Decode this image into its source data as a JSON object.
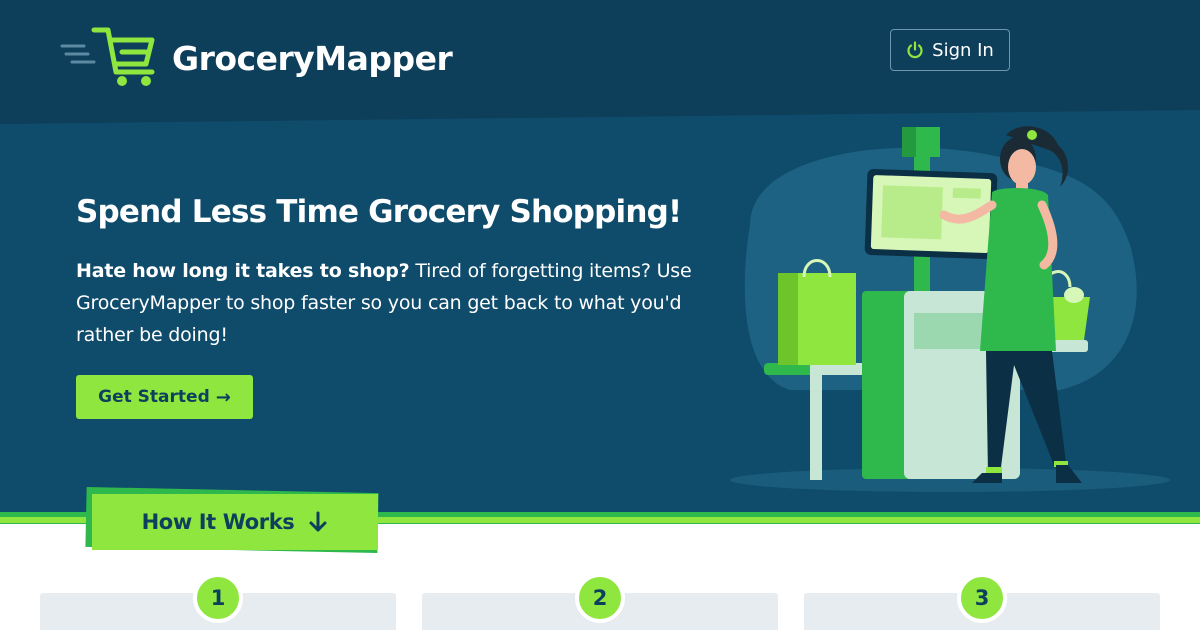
{
  "header": {
    "brand": "GroceryMapper",
    "signin_label": "Sign In"
  },
  "hero": {
    "headline": "Spend Less Time Grocery Shopping!",
    "lede_bold": "Hate how long it takes to shop?",
    "lede_rest": " Tired of forgetting items? Use GroceryMapper to shop faster so you can get back to what you'd rather be doing!",
    "cta_label": "Get Started",
    "cta_arrow": "→"
  },
  "how_it_works": {
    "label": "How It Works",
    "steps": [
      {
        "number": "1"
      },
      {
        "number": "2"
      },
      {
        "number": "3"
      }
    ]
  },
  "icons": [
    "cart-logo-icon",
    "power-icon",
    "arrow-right-icon",
    "arrow-down-icon"
  ],
  "colors": {
    "navy": "#0e3f5c",
    "lime": "#8fe63f",
    "green": "#2fb84c",
    "card": "#e6ecf0"
  }
}
